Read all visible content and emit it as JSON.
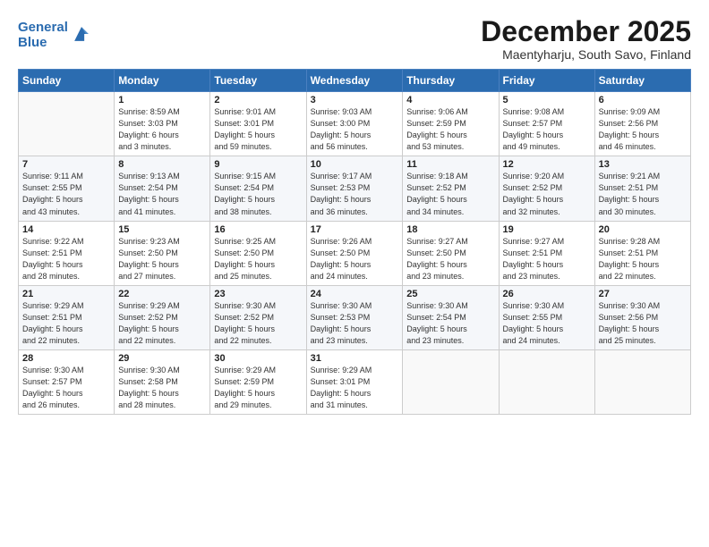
{
  "logo": {
    "line1": "General",
    "line2": "Blue"
  },
  "title": "December 2025",
  "subtitle": "Maentyharju, South Savo, Finland",
  "days_header": [
    "Sunday",
    "Monday",
    "Tuesday",
    "Wednesday",
    "Thursday",
    "Friday",
    "Saturday"
  ],
  "weeks": [
    [
      {
        "num": "",
        "info": ""
      },
      {
        "num": "1",
        "info": "Sunrise: 8:59 AM\nSunset: 3:03 PM\nDaylight: 6 hours\nand 3 minutes."
      },
      {
        "num": "2",
        "info": "Sunrise: 9:01 AM\nSunset: 3:01 PM\nDaylight: 5 hours\nand 59 minutes."
      },
      {
        "num": "3",
        "info": "Sunrise: 9:03 AM\nSunset: 3:00 PM\nDaylight: 5 hours\nand 56 minutes."
      },
      {
        "num": "4",
        "info": "Sunrise: 9:06 AM\nSunset: 2:59 PM\nDaylight: 5 hours\nand 53 minutes."
      },
      {
        "num": "5",
        "info": "Sunrise: 9:08 AM\nSunset: 2:57 PM\nDaylight: 5 hours\nand 49 minutes."
      },
      {
        "num": "6",
        "info": "Sunrise: 9:09 AM\nSunset: 2:56 PM\nDaylight: 5 hours\nand 46 minutes."
      }
    ],
    [
      {
        "num": "7",
        "info": "Sunrise: 9:11 AM\nSunset: 2:55 PM\nDaylight: 5 hours\nand 43 minutes."
      },
      {
        "num": "8",
        "info": "Sunrise: 9:13 AM\nSunset: 2:54 PM\nDaylight: 5 hours\nand 41 minutes."
      },
      {
        "num": "9",
        "info": "Sunrise: 9:15 AM\nSunset: 2:54 PM\nDaylight: 5 hours\nand 38 minutes."
      },
      {
        "num": "10",
        "info": "Sunrise: 9:17 AM\nSunset: 2:53 PM\nDaylight: 5 hours\nand 36 minutes."
      },
      {
        "num": "11",
        "info": "Sunrise: 9:18 AM\nSunset: 2:52 PM\nDaylight: 5 hours\nand 34 minutes."
      },
      {
        "num": "12",
        "info": "Sunrise: 9:20 AM\nSunset: 2:52 PM\nDaylight: 5 hours\nand 32 minutes."
      },
      {
        "num": "13",
        "info": "Sunrise: 9:21 AM\nSunset: 2:51 PM\nDaylight: 5 hours\nand 30 minutes."
      }
    ],
    [
      {
        "num": "14",
        "info": "Sunrise: 9:22 AM\nSunset: 2:51 PM\nDaylight: 5 hours\nand 28 minutes."
      },
      {
        "num": "15",
        "info": "Sunrise: 9:23 AM\nSunset: 2:50 PM\nDaylight: 5 hours\nand 27 minutes."
      },
      {
        "num": "16",
        "info": "Sunrise: 9:25 AM\nSunset: 2:50 PM\nDaylight: 5 hours\nand 25 minutes."
      },
      {
        "num": "17",
        "info": "Sunrise: 9:26 AM\nSunset: 2:50 PM\nDaylight: 5 hours\nand 24 minutes."
      },
      {
        "num": "18",
        "info": "Sunrise: 9:27 AM\nSunset: 2:50 PM\nDaylight: 5 hours\nand 23 minutes."
      },
      {
        "num": "19",
        "info": "Sunrise: 9:27 AM\nSunset: 2:51 PM\nDaylight: 5 hours\nand 23 minutes."
      },
      {
        "num": "20",
        "info": "Sunrise: 9:28 AM\nSunset: 2:51 PM\nDaylight: 5 hours\nand 22 minutes."
      }
    ],
    [
      {
        "num": "21",
        "info": "Sunrise: 9:29 AM\nSunset: 2:51 PM\nDaylight: 5 hours\nand 22 minutes."
      },
      {
        "num": "22",
        "info": "Sunrise: 9:29 AM\nSunset: 2:52 PM\nDaylight: 5 hours\nand 22 minutes."
      },
      {
        "num": "23",
        "info": "Sunrise: 9:30 AM\nSunset: 2:52 PM\nDaylight: 5 hours\nand 22 minutes."
      },
      {
        "num": "24",
        "info": "Sunrise: 9:30 AM\nSunset: 2:53 PM\nDaylight: 5 hours\nand 23 minutes."
      },
      {
        "num": "25",
        "info": "Sunrise: 9:30 AM\nSunset: 2:54 PM\nDaylight: 5 hours\nand 23 minutes."
      },
      {
        "num": "26",
        "info": "Sunrise: 9:30 AM\nSunset: 2:55 PM\nDaylight: 5 hours\nand 24 minutes."
      },
      {
        "num": "27",
        "info": "Sunrise: 9:30 AM\nSunset: 2:56 PM\nDaylight: 5 hours\nand 25 minutes."
      }
    ],
    [
      {
        "num": "28",
        "info": "Sunrise: 9:30 AM\nSunset: 2:57 PM\nDaylight: 5 hours\nand 26 minutes."
      },
      {
        "num": "29",
        "info": "Sunrise: 9:30 AM\nSunset: 2:58 PM\nDaylight: 5 hours\nand 28 minutes."
      },
      {
        "num": "30",
        "info": "Sunrise: 9:29 AM\nSunset: 2:59 PM\nDaylight: 5 hours\nand 29 minutes."
      },
      {
        "num": "31",
        "info": "Sunrise: 9:29 AM\nSunset: 3:01 PM\nDaylight: 5 hours\nand 31 minutes."
      },
      {
        "num": "",
        "info": ""
      },
      {
        "num": "",
        "info": ""
      },
      {
        "num": "",
        "info": ""
      }
    ]
  ]
}
